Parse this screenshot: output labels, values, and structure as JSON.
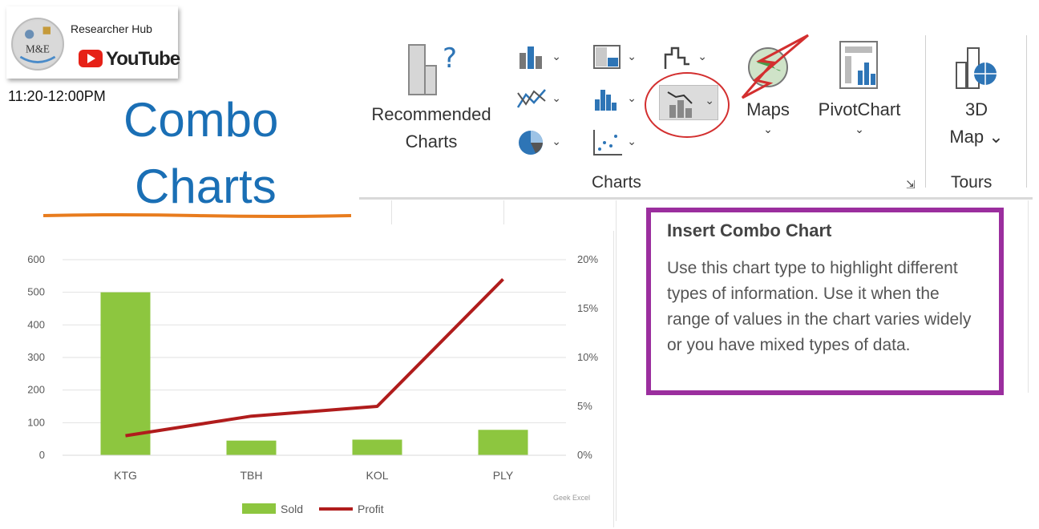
{
  "overlay": {
    "channel_name": "Researcher Hub",
    "youtube_label": "YouTube",
    "logo_text": "M&E",
    "time": "11:20-12:00PM",
    "title_line1": "Combo",
    "title_line2": "Charts"
  },
  "ribbon": {
    "recommended_line1": "Recommended",
    "recommended_line2": "Charts",
    "maps_label": "Maps",
    "maps_caret": "⌄",
    "pivot_label": "PivotChart",
    "pivot_caret": "⌄",
    "map3d_line1": "3D",
    "map3d_line2": "Map ⌄",
    "group_charts": "Charts",
    "group_tours": "Tours",
    "icons": [
      "column-chart-icon",
      "hierarchy-chart-icon",
      "waterfall-chart-icon",
      "line-chart-icon",
      "statistic-chart-icon",
      "combo-chart-icon",
      "pie-chart-icon",
      "scatter-chart-icon"
    ],
    "accent": "#2e75b6"
  },
  "tooltip": {
    "title": "Insert Combo Chart",
    "body": "Use this chart type to highlight different types of information. Use it when the range of values in the chart varies widely or you have mixed types of data."
  },
  "chart_data": {
    "type": "bar",
    "categories": [
      "KTG",
      "TBH",
      "KOL",
      "PLY"
    ],
    "series": [
      {
        "name": "Sold",
        "type": "bar",
        "axis": "left",
        "values": [
          500,
          45,
          48,
          78
        ],
        "color": "#8dc63f"
      },
      {
        "name": "Profit",
        "type": "line",
        "axis": "right",
        "values": [
          0.02,
          0.04,
          0.05,
          0.18
        ],
        "color": "#b01c1c"
      }
    ],
    "y_left": {
      "ylim": [
        0,
        600
      ],
      "ticks": [
        "0",
        "100",
        "200",
        "300",
        "400",
        "500",
        "600"
      ]
    },
    "y_right": {
      "ylim": [
        0,
        0.2
      ],
      "ticks": [
        "0%",
        "5%",
        "10%",
        "15%",
        "20%"
      ]
    },
    "grid": true,
    "legend": "bottom"
  },
  "watermark": "Geek Excel"
}
